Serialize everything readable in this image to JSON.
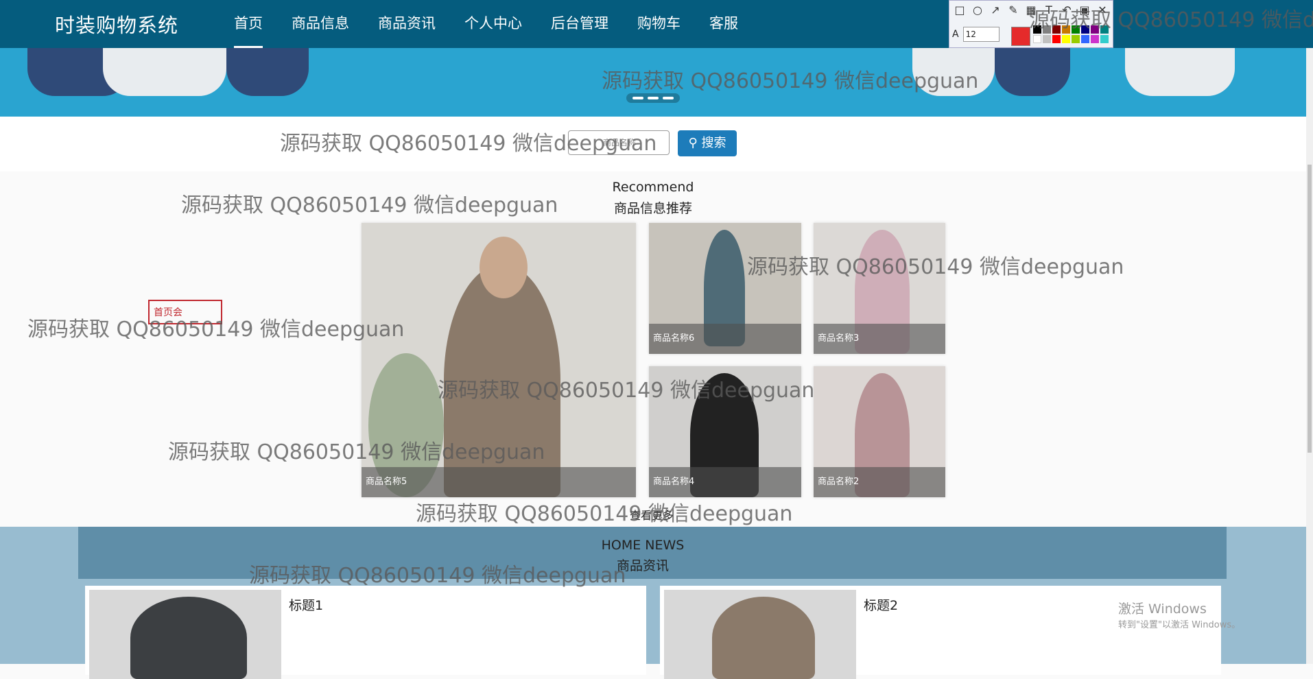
{
  "nav": {
    "brand": "时装购物系统",
    "items": [
      "首页",
      "商品信息",
      "商品资讯",
      "个人中心",
      "后台管理",
      "购物车",
      "客服"
    ]
  },
  "toolbar": {
    "font_size": "12",
    "current_color": "#e52b2b"
  },
  "search": {
    "placeholder": "商品名称",
    "button": "搜索"
  },
  "recommend": {
    "title_en": "Recommend",
    "title_cn": "商品信息推荐",
    "items": [
      {
        "name": "商品名称5"
      },
      {
        "name": "商品名称6"
      },
      {
        "name": "商品名称3"
      },
      {
        "name": "商品名称4"
      },
      {
        "name": "商品名称2"
      }
    ],
    "more": "查看更多"
  },
  "annotation_box": "首页会",
  "news": {
    "title_en": "HOME NEWS",
    "title_cn": "商品资讯",
    "items": [
      {
        "title": "标题1"
      },
      {
        "title": "标题2"
      }
    ]
  },
  "watermark": "源码获取 QQ86050149 微信deepguan",
  "windows": {
    "line1": "激活 Windows",
    "line2": "转到\"设置\"以激活 Windows。"
  }
}
